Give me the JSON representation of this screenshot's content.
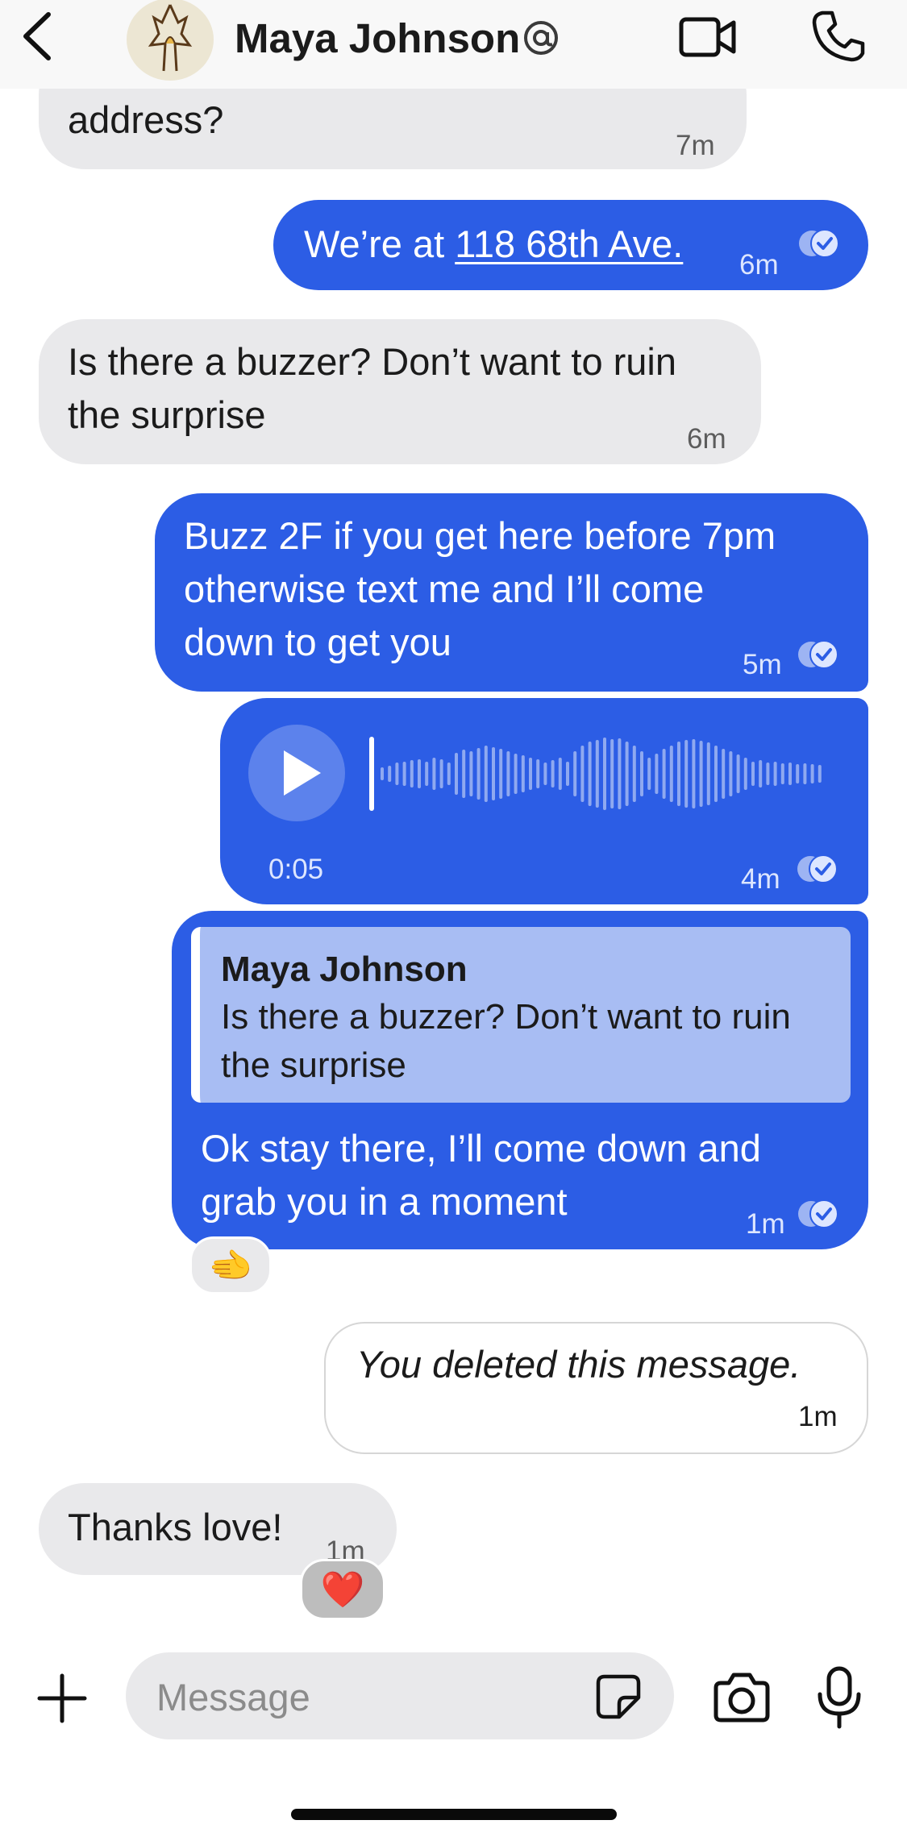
{
  "header": {
    "contact_name": "Maya Johnson",
    "icons": [
      "back-icon",
      "avatar",
      "at-icon",
      "video-icon",
      "phone-icon"
    ]
  },
  "messages": [
    {
      "id": "m1",
      "direction": "incoming",
      "text": "address?",
      "time": "7m"
    },
    {
      "id": "m2",
      "direction": "outgoing",
      "text_prefix": "We’re at ",
      "link": "118 68th Ave.",
      "time": "6m",
      "read": true
    },
    {
      "id": "m3",
      "direction": "incoming",
      "lines": [
        "Is there a buzzer? Don’t want to ruin",
        "the surprise"
      ],
      "time": "6m"
    },
    {
      "id": "m4",
      "direction": "outgoing",
      "lines": [
        "Buzz 2F if you get here before 7pm",
        "otherwise text me and I’ll come",
        "down to get you"
      ],
      "time": "5m",
      "read": true
    },
    {
      "id": "m5",
      "direction": "outgoing",
      "type": "voice",
      "duration": "0:05",
      "time": "4m",
      "read": true
    },
    {
      "id": "m6",
      "direction": "outgoing",
      "reply_to": {
        "name": "Maya Johnson",
        "lines": [
          "Is there a buzzer? Don’t want to ruin",
          "the surprise"
        ]
      },
      "lines": [
        "Ok stay there, I’ll come down and",
        "grab you in a moment"
      ],
      "time": "1m",
      "read": true,
      "reaction": "🫲"
    },
    {
      "id": "m7",
      "direction": "outgoing",
      "deleted": true,
      "text": "You deleted this message.",
      "time": "1m"
    },
    {
      "id": "m8",
      "direction": "incoming",
      "text": "Thanks love!",
      "time": "1m",
      "reaction": "❤️"
    }
  ],
  "composer": {
    "placeholder": "Message"
  },
  "colors": {
    "outgoing_bubble": "#2c5de5",
    "incoming_bubble": "#e9e9eb",
    "quote_background": "#a8bdf3"
  }
}
